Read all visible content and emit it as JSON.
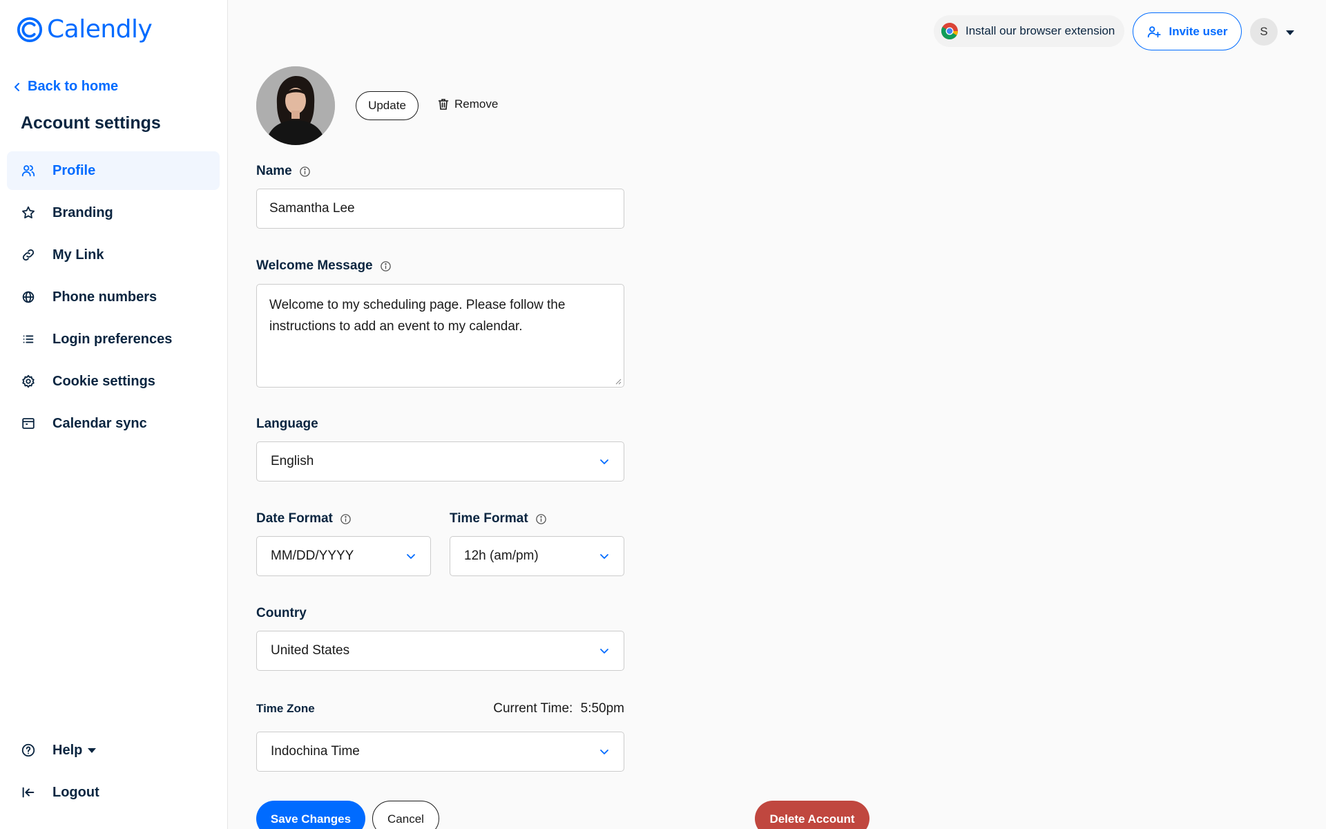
{
  "brand": {
    "name": "Calendly",
    "color": "#006bff"
  },
  "sidebar": {
    "back_label": "Back to home",
    "title": "Account settings",
    "items": [
      {
        "label": "Profile",
        "icon": "users-icon",
        "active": true
      },
      {
        "label": "Branding",
        "icon": "star-icon",
        "active": false
      },
      {
        "label": "My Link",
        "icon": "link-icon",
        "active": false
      },
      {
        "label": "Phone numbers",
        "icon": "globe-icon",
        "active": false
      },
      {
        "label": "Login preferences",
        "icon": "list-icon",
        "active": false
      },
      {
        "label": "Cookie settings",
        "icon": "gear-icon",
        "active": false
      },
      {
        "label": "Calendar sync",
        "icon": "calendar-icon",
        "active": false
      }
    ],
    "help_label": "Help",
    "logout_label": "Logout"
  },
  "header": {
    "extension_label": "Install our browser extension",
    "invite_label": "Invite user",
    "avatar_initial": "S"
  },
  "profile": {
    "update_label": "Update",
    "remove_label": "Remove",
    "name_label": "Name",
    "name_value": "Samantha Lee",
    "welcome_label": "Welcome Message",
    "welcome_value": "Welcome to my scheduling page. Please follow the instructions to add an event to my calendar.",
    "language_label": "Language",
    "language_value": "English",
    "date_format_label": "Date Format",
    "date_format_value": "MM/DD/YYYY",
    "time_format_label": "Time Format",
    "time_format_value": "12h (am/pm)",
    "country_label": "Country",
    "country_value": "United States",
    "timezone_label": "Time Zone",
    "current_time_label": "Current Time:",
    "current_time_value": "5:50pm",
    "timezone_value": "Indochina Time"
  },
  "actions": {
    "save_label": "Save Changes",
    "cancel_label": "Cancel",
    "delete_label": "Delete Account",
    "delete_color": "#c0473f"
  }
}
